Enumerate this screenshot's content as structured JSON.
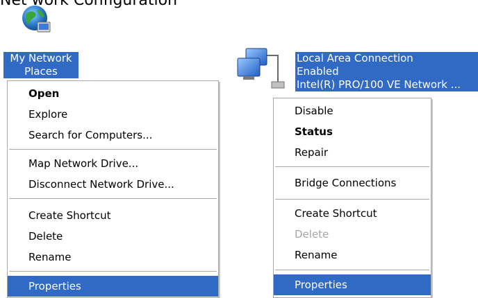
{
  "heading": {
    "text": "Net work Configuration"
  },
  "desktop": {
    "my_network_places": {
      "label_line1": "My Network",
      "label_line2": "Places",
      "icon": "network-globe-icon"
    },
    "local_area_connection": {
      "name": "Local Area Connection",
      "status": "Enabled",
      "device": "Intel(R) PRO/100 VE Network ...",
      "icon": "network-connection-icon"
    }
  },
  "menu_left": {
    "open": "Open",
    "explore": "Explore",
    "search_for_computers": "Search for Computers...",
    "map_network_drive": "Map Network Drive...",
    "disconnect_network_drive": "Disconnect Network Drive...",
    "create_shortcut": "Create Shortcut",
    "delete": "Delete",
    "rename": "Rename",
    "properties": "Properties"
  },
  "menu_right": {
    "disable": "Disable",
    "status": "Status",
    "repair": "Repair",
    "bridge_connections": "Bridge Connections",
    "create_shortcut": "Create Shortcut",
    "delete": "Delete",
    "rename": "Rename",
    "properties": "Properties"
  },
  "colors": {
    "selection": "#316ac5",
    "disabled_text": "#a5a5a5",
    "separator": "#a7a7a7"
  }
}
